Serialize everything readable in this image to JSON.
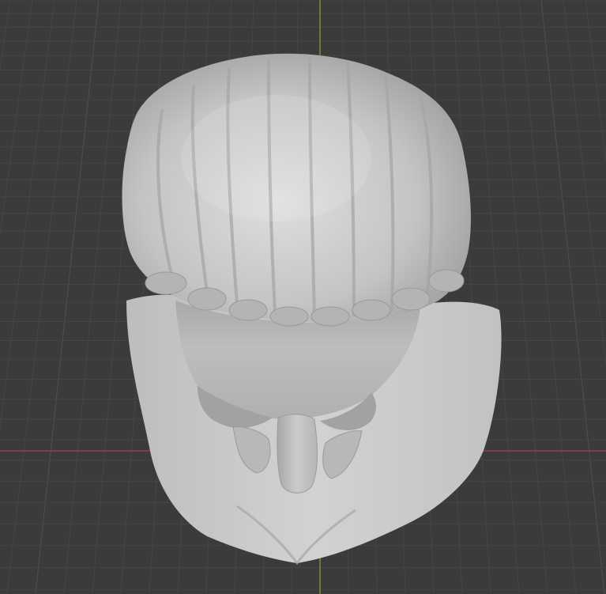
{
  "viewport": {
    "kind": "3d-viewport",
    "background_color": "#3b3b3b",
    "grid_color": "#505050",
    "grid_minor_color": "#454545",
    "x_axis_color": "#a8404a",
    "y_axis_color": "#7ea63a"
  },
  "model": {
    "name": "bust-sculpt",
    "surface_color": "#c9c9c9",
    "shadow_color": "#8f8f8f",
    "highlight_color": "#e4e4e4"
  }
}
